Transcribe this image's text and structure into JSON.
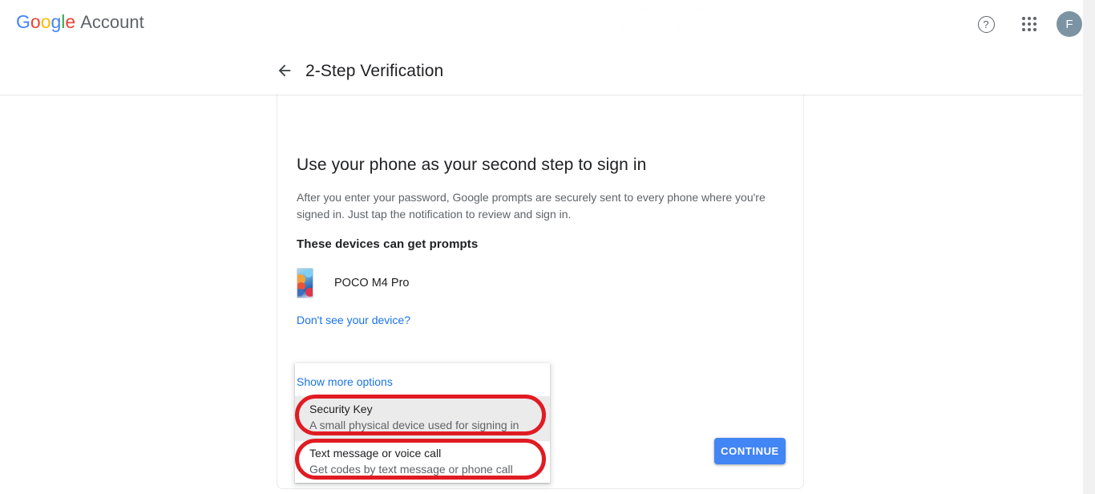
{
  "topbar": {
    "brand_google": "Google",
    "brand_product": "Account",
    "help_icon_label": "?",
    "apps_icon_name": "apps-grid-icon",
    "avatar_initial": "F"
  },
  "subheader": {
    "back_label": "←",
    "title": "2-Step Verification"
  },
  "main": {
    "headline": "Use your phone as your second step to sign in",
    "subtext": "After you enter your password, Google prompts are securely sent to every phone where you're signed in. Just tap the notification to review and sign in.",
    "section_title": "These devices can get prompts",
    "device_name": "POCO M4 Pro",
    "dont_see_device_link": "Don't see your device?",
    "continue_label": "CONTINUE"
  },
  "options_panel": {
    "show_more_label": "Show more options",
    "options": [
      {
        "title": "Security Key",
        "subtitle": "A small physical device used for signing in",
        "hovered": true
      },
      {
        "title": "Text message or voice call",
        "subtitle": "Get codes by text message or phone call",
        "hovered": false
      }
    ]
  },
  "colors": {
    "accent_blue": "#4285f4",
    "link_blue": "#1a73e8",
    "annotation_red": "#e01b22",
    "avatar_bg": "#7c93a3",
    "hover_gray": "#ebebeb"
  }
}
